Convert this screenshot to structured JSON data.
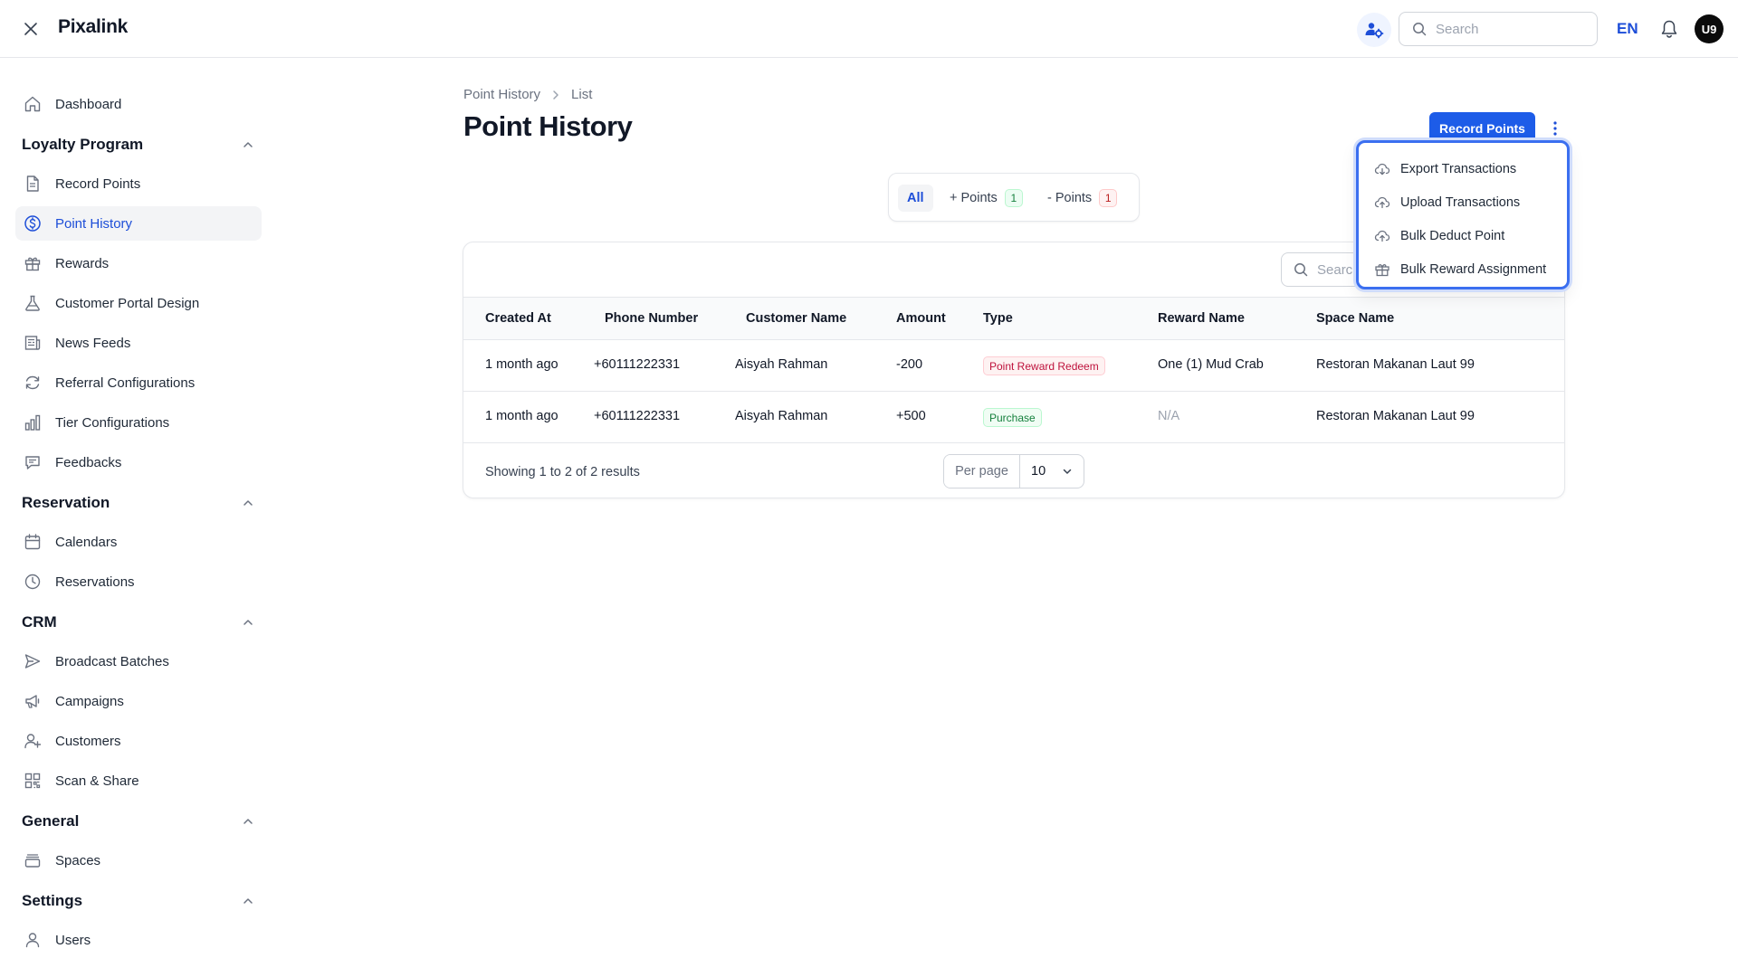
{
  "app": {
    "brand": "Pixalink",
    "user_initials": "U9",
    "language": "EN"
  },
  "topbar": {
    "search_placeholder": "Search"
  },
  "sidebar": {
    "dashboard": "Dashboard",
    "sections": {
      "loyalty": "Loyalty Program",
      "reservation": "Reservation",
      "crm": "CRM",
      "general": "General",
      "settings": "Settings"
    },
    "items": {
      "record_points": "Record Points",
      "point_history": "Point History",
      "rewards": "Rewards",
      "portal_design": "Customer Portal Design",
      "news_feeds": "News Feeds",
      "referral": "Referral Configurations",
      "tier": "Tier Configurations",
      "feedbacks": "Feedbacks",
      "calendars": "Calendars",
      "reservations": "Reservations",
      "broadcast": "Broadcast Batches",
      "campaigns": "Campaigns",
      "customers": "Customers",
      "scan_share": "Scan & Share",
      "spaces": "Spaces",
      "users": "Users"
    }
  },
  "breadcrumb": {
    "parent": "Point History",
    "current": "List"
  },
  "page": {
    "title": "Point History",
    "record_button": "Record Points"
  },
  "menu": {
    "export": "Export Transactions",
    "upload": "Upload Transactions",
    "bulk_deduct": "Bulk Deduct Point",
    "bulk_reward": "Bulk Reward Assignment"
  },
  "tabs": {
    "all": "All",
    "plus": "+ Points",
    "plus_count": "1",
    "minus": "- Points",
    "minus_count": "1"
  },
  "table": {
    "search_placeholder": "Search",
    "headers": {
      "created_at": "Created At",
      "phone": "Phone Number",
      "customer": "Customer Name",
      "amount": "Amount",
      "type": "Type",
      "reward": "Reward Name",
      "space": "Space Name"
    },
    "rows": [
      {
        "created_at": "1 month ago",
        "phone": "+60111222331",
        "customer": "Aisyah Rahman",
        "amount": "-200",
        "type": "Point Reward Redeem",
        "reward": "One (1) Mud Crab",
        "space": "Restoran Makanan Laut 99"
      },
      {
        "created_at": "1 month ago",
        "phone": "+60111222331",
        "customer": "Aisyah Rahman",
        "amount": "+500",
        "type": "Purchase",
        "reward": "N/A",
        "space": "Restoran Makanan Laut 99"
      }
    ],
    "showing": "Showing 1 to 2 of 2 results",
    "per_page_label": "Per page",
    "per_page_value": "10"
  },
  "colors": {
    "accent": "#1d5ce8",
    "link": "#1d4ed8",
    "menu_border": "#3b6ff0"
  }
}
